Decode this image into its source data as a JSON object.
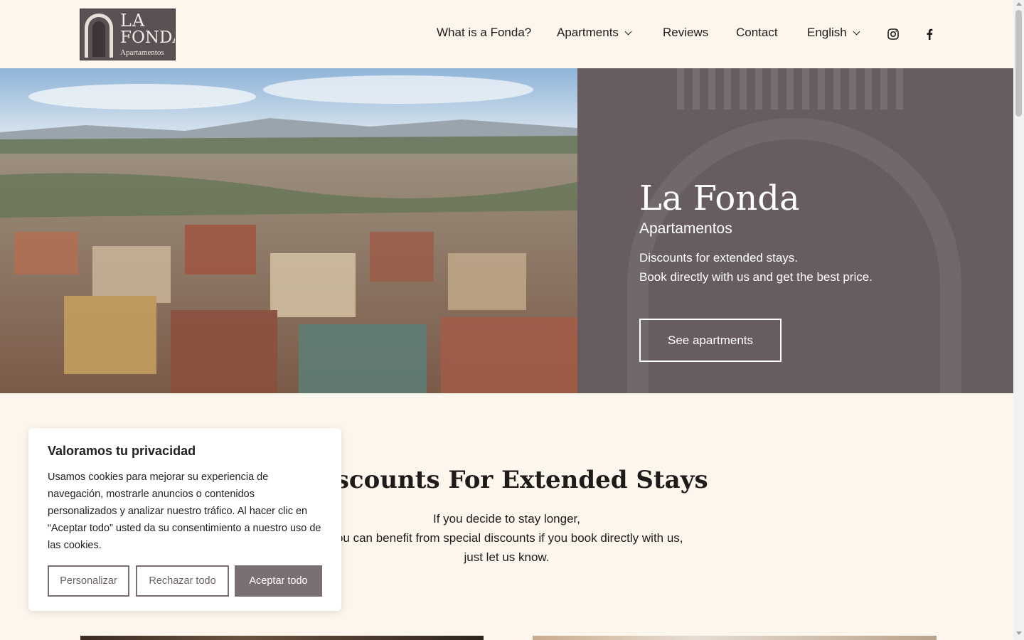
{
  "brand": {
    "logo_line1": "LA",
    "logo_line2": "FONDA",
    "logo_line3": "Apartamentos"
  },
  "nav": {
    "items": [
      {
        "label": "What is a Fonda?"
      },
      {
        "label": "Apartments"
      },
      {
        "label": "Reviews"
      },
      {
        "label": "Contact"
      },
      {
        "label": "English"
      }
    ],
    "social": [
      "instagram-icon",
      "facebook-icon"
    ]
  },
  "hero": {
    "title": "La Fonda",
    "subtitle": "Apartamentos",
    "line1": "Discounts for extended stays.",
    "line2": "Book directly with us and get the best price.",
    "button": "See apartments"
  },
  "discounts": {
    "title": "Discounts For Extended Stays",
    "line1": "If you decide to stay longer,",
    "line2": "you can benefit from special discounts if you book directly with us,",
    "line3": "just let us know."
  },
  "cookie": {
    "title": "Valoramos tu privacidad",
    "text": "Usamos cookies para mejorar su experiencia de navegación, mostrarle anuncios o contenidos personalizados y analizar nuestro tráfico. Al hacer clic en “Aceptar todo” usted da su consentimiento a nuestro uso de las cookies.",
    "customize": "Personalizar",
    "reject": "Rechazar todo",
    "accept": "Aceptar todo"
  },
  "colors": {
    "background": "#fdf6ec",
    "panel": "#675d5f",
    "accent_button": "#7a7072"
  }
}
